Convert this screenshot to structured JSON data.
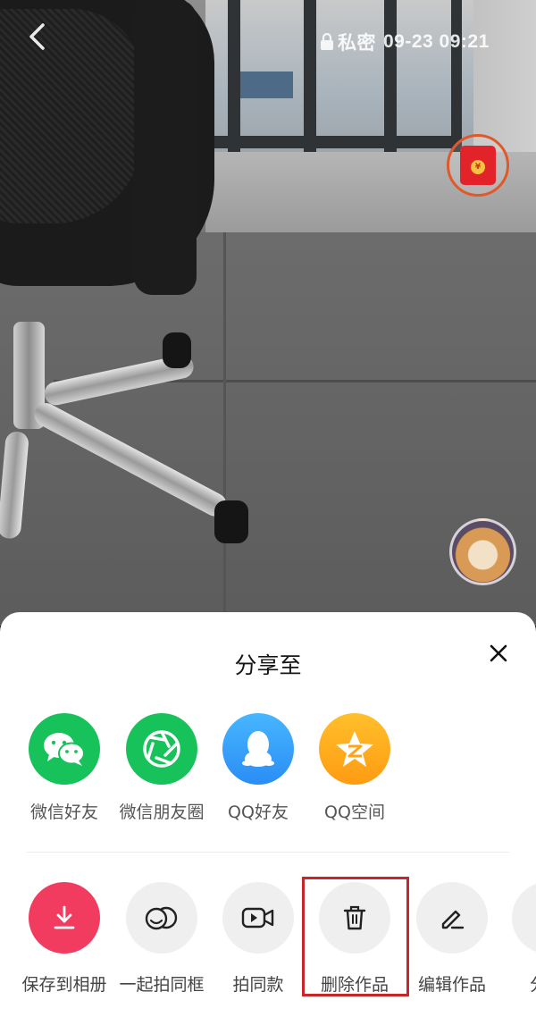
{
  "video": {
    "status": {
      "privacy_label": "私密",
      "timestamp": "09-23 09:21"
    },
    "colors": {
      "accent_red": "#e2242a",
      "ring_orange": "#e0592a"
    },
    "icons": [
      "back-arrow-icon",
      "lock-icon",
      "red-envelope-icon",
      "avatar"
    ],
    "red_envelope_symbol": "¥"
  },
  "share_sheet": {
    "title": "分享至",
    "share_targets": [
      {
        "label": "微信好友",
        "icon": "wechat-icon",
        "color": "#17c25b"
      },
      {
        "label": "微信朋友圈",
        "icon": "moments-icon",
        "color": "#17c25b"
      },
      {
        "label": "QQ好友",
        "icon": "qq-icon",
        "color": "#2fa6ff"
      },
      {
        "label": "QQ空间",
        "icon": "qzone-icon",
        "color": "#ffab1a"
      }
    ],
    "actions": [
      {
        "label": "保存到相册",
        "icon": "download-icon",
        "color": "#f23c5f"
      },
      {
        "label": "一起拍同框",
        "icon": "duet-icon"
      },
      {
        "label": "拍同款",
        "icon": "video-camera-icon"
      },
      {
        "label": "删除作品",
        "icon": "trash-icon",
        "highlighted": true
      },
      {
        "label": "编辑作品",
        "icon": "edit-pencil-icon"
      },
      {
        "label": "分",
        "icon": "more-icon"
      }
    ],
    "highlight_color": "#c8262a"
  }
}
